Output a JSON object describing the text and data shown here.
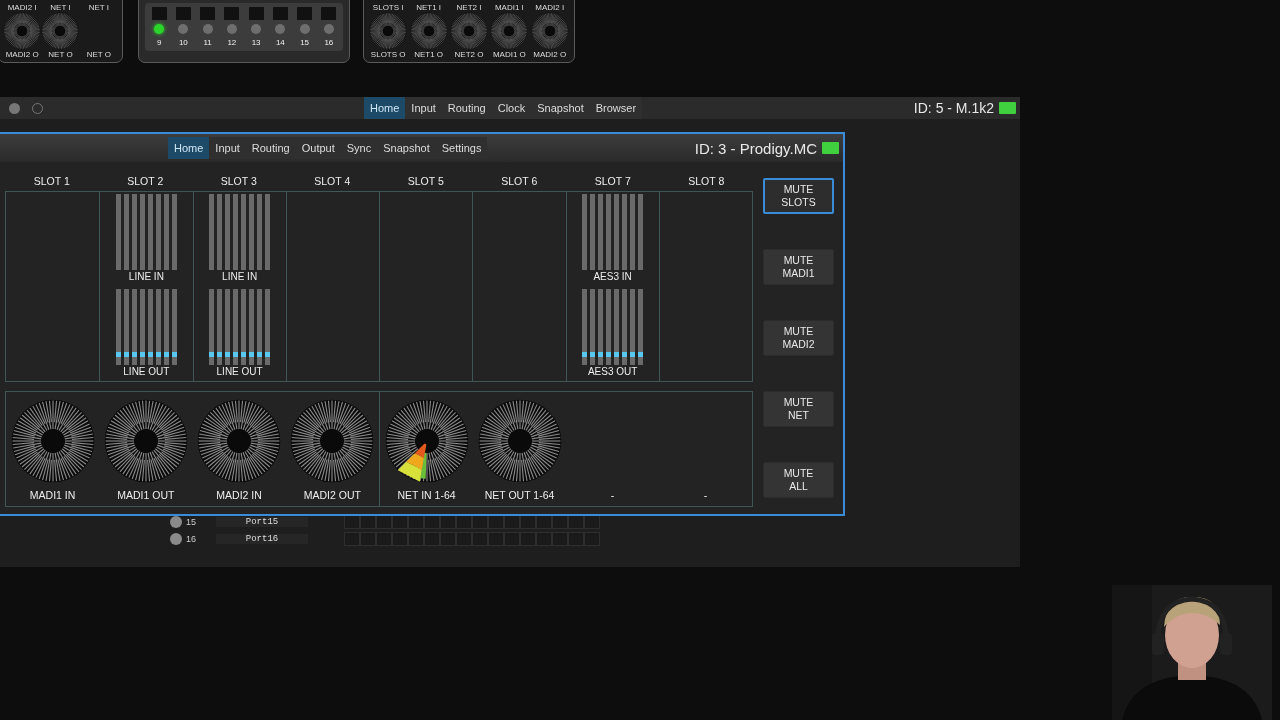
{
  "background_window": {
    "knob_panel_1": [
      {
        "top": "MADI2 I",
        "bottom": "MADI2 O",
        "kind": "knob"
      },
      {
        "top": "NET I",
        "bottom": "NET O",
        "kind": "knob"
      },
      {
        "top": "NET I",
        "bottom": "NET O",
        "kind": "labels"
      }
    ],
    "led_panel": [
      {
        "number": "9",
        "on": true
      },
      {
        "number": "10",
        "on": false
      },
      {
        "number": "11",
        "on": false
      },
      {
        "number": "12",
        "on": false
      },
      {
        "number": "13",
        "on": false
      },
      {
        "number": "14",
        "on": false
      },
      {
        "number": "15",
        "on": false
      },
      {
        "number": "16",
        "on": false
      }
    ],
    "knob_panel_2": [
      {
        "top": "SLOTS I",
        "bottom": "SLOTS O",
        "kind": "knob"
      },
      {
        "top": "NET1 I",
        "bottom": "NET1 O",
        "kind": "knob"
      },
      {
        "top": "NET2 I",
        "bottom": "NET2 O",
        "kind": "knob"
      },
      {
        "top": "MADI1 I",
        "bottom": "MADI1 O",
        "kind": "knob"
      },
      {
        "top": "MADI2 I",
        "bottom": "MADI2 O",
        "kind": "knob"
      }
    ]
  },
  "device_window": {
    "tabs": [
      {
        "label": "Home",
        "selected": true
      },
      {
        "label": "Input",
        "selected": false
      },
      {
        "label": "Routing",
        "selected": false
      },
      {
        "label": "Clock",
        "selected": false
      },
      {
        "label": "Snapshot",
        "selected": false
      },
      {
        "label": "Browser",
        "selected": false
      }
    ],
    "device_id": "ID: 5 - M.1k2",
    "port_rows": [
      {
        "number": "15",
        "name": "Port15"
      },
      {
        "number": "16",
        "name": "Port16"
      }
    ]
  },
  "main_window": {
    "tabs": [
      {
        "label": "Home",
        "selected": true
      },
      {
        "label": "Input",
        "selected": false
      },
      {
        "label": "Routing",
        "selected": false
      },
      {
        "label": "Output",
        "selected": false
      },
      {
        "label": "Sync",
        "selected": false
      },
      {
        "label": "Snapshot",
        "selected": false
      },
      {
        "label": "Settings",
        "selected": false
      }
    ],
    "device_id": "ID: 3 - Prodigy.MC",
    "slots": [
      {
        "title": "SLOT 1"
      },
      {
        "title": "SLOT 2",
        "meters": [
          {
            "label": "LINE IN",
            "signal": false
          },
          {
            "label": "LINE OUT",
            "signal": true
          }
        ]
      },
      {
        "title": "SLOT 3",
        "meters": [
          {
            "label": "LINE IN",
            "signal": false
          },
          {
            "label": "LINE OUT",
            "signal": true
          }
        ]
      },
      {
        "title": "SLOT 4"
      },
      {
        "title": "SLOT 5"
      },
      {
        "title": "SLOT 6"
      },
      {
        "title": "SLOT 7",
        "meters": [
          {
            "label": "AES3 IN",
            "signal": false
          },
          {
            "label": "AES3 OUT",
            "signal": true
          }
        ]
      },
      {
        "title": "SLOT 8"
      }
    ],
    "wheels_left": [
      {
        "label": "MADI1 IN",
        "kind": "wheel",
        "active": false
      },
      {
        "label": "MADI1 OUT",
        "kind": "wheel",
        "active": false
      },
      {
        "label": "MADI2 IN",
        "kind": "wheel",
        "active": false
      },
      {
        "label": "MADI2 OUT",
        "kind": "wheel",
        "active": false
      }
    ],
    "wheels_right": [
      {
        "label": "NET IN 1-64",
        "kind": "wheel",
        "active": true
      },
      {
        "label": "NET OUT 1-64",
        "kind": "wheel",
        "active": false
      },
      {
        "label": "-",
        "kind": "empty"
      },
      {
        "label": "-",
        "kind": "empty"
      }
    ],
    "mute_buttons": [
      {
        "label": "MUTE\nSLOTS",
        "selected": true
      },
      {
        "label": "MUTE\nMADI1",
        "selected": false
      },
      {
        "label": "MUTE\nMADI2",
        "selected": false
      },
      {
        "label": "MUTE\nNET",
        "selected": false
      },
      {
        "label": "MUTE\nALL",
        "selected": false
      }
    ]
  }
}
